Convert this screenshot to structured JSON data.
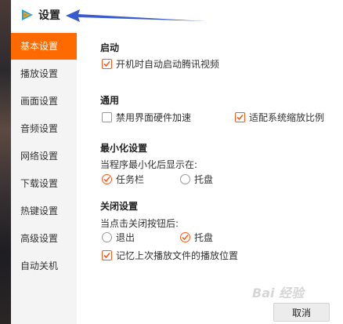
{
  "window": {
    "title": "设置",
    "logo_icon": "tencent-video-logo-icon"
  },
  "sidebar": {
    "items": [
      {
        "label": "基本设置",
        "active": true
      },
      {
        "label": "播放设置",
        "active": false
      },
      {
        "label": "画面设置",
        "active": false
      },
      {
        "label": "音频设置",
        "active": false
      },
      {
        "label": "网络设置",
        "active": false
      },
      {
        "label": "下载设置",
        "active": false
      },
      {
        "label": "热键设置",
        "active": false
      },
      {
        "label": "高级设置",
        "active": false
      },
      {
        "label": "自动关机",
        "active": false
      }
    ]
  },
  "main": {
    "startup": {
      "heading": "启动",
      "auto_start": {
        "label": "开机时自动启动腾讯视频",
        "checked": true
      }
    },
    "general": {
      "heading": "通用",
      "disable_hw_accel": {
        "label": "禁用界面硬件加速",
        "checked": false
      },
      "fit_system_scaling": {
        "label": "适配系统缩放比例",
        "checked": true
      }
    },
    "minimize": {
      "heading": "最小化设置",
      "prompt": "当程序最小化后显示在:",
      "taskbar": {
        "label": "任务栏",
        "selected": true
      },
      "tray": {
        "label": "托盘",
        "selected": false
      }
    },
    "close": {
      "heading": "关闭设置",
      "prompt": "当点击关闭按钮后:",
      "exit": {
        "label": "退出",
        "selected": false
      },
      "tray": {
        "label": "托盘",
        "selected": true
      },
      "remember_position": {
        "label": "记忆上次播放文件的播放位置",
        "checked": true
      }
    }
  },
  "footer": {
    "cancel_label": "取消",
    "watermark": "Bai 经验"
  },
  "colors": {
    "accent": "#ff6a00",
    "annotation_arrow": "#3a5bd0"
  }
}
